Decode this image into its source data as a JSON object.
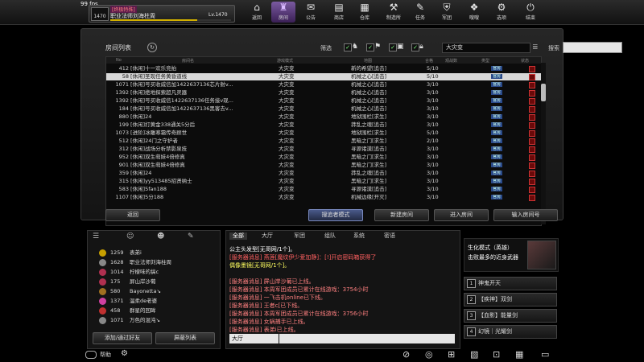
{
  "fps": "99 fps",
  "profile": {
    "rank": "1470",
    "tag": "[终极特殊]",
    "name": "职业法师刘海柱周",
    "level": "Lv.1470",
    "xp_fraction": 0.72
  },
  "topnav": [
    {
      "label": "返回",
      "icon": "⌂"
    },
    {
      "label": "房间",
      "icon": "♜"
    },
    {
      "label": "公告",
      "icon": "✉"
    },
    {
      "label": "商店",
      "icon": "▤"
    },
    {
      "label": "仓库",
      "icon": "▦"
    },
    {
      "label": "制造所",
      "icon": "⚒"
    },
    {
      "label": "任务",
      "icon": "✎"
    },
    {
      "label": "军团",
      "icon": "⛨"
    },
    {
      "label": "嗖嗖",
      "icon": "❖"
    },
    {
      "label": "选项",
      "icon": "⚙"
    },
    {
      "label": "结束",
      "icon": "⏻"
    }
  ],
  "room_list": {
    "title": "房间列表",
    "filter_label": "筛选",
    "mode_value": "大灾变",
    "search_label": "搜索",
    "search_value": "",
    "columns": [
      "No",
      "房间名",
      "游戏模式",
      "地图",
      "合格",
      "观战数",
      "类型",
      "状态"
    ],
    "rows": [
      {
        "no": "412",
        "name": "[休闲]十一欢乐竞拍",
        "mode": "大灾变",
        "map": "新的希望[追击]",
        "count": "5/10",
        "badge": "官房"
      },
      {
        "no": "58",
        "name": "[休闲]圣现任务黄昏道线",
        "mode": "大灾变",
        "map": "机械之心[追击]",
        "count": "5/10",
        "badge": "官房",
        "selected": true
      },
      {
        "no": "1071",
        "name": "[休闲]号买收威信加1422637136芯片射v...",
        "mode": "大灾变",
        "map": "机械之心[追击]",
        "count": "3/10",
        "badge": "官房"
      },
      {
        "no": "1392",
        "name": "[休闲]绝地探索超凡灵器",
        "mode": "大灾变",
        "map": "机械之心[追击]",
        "count": "3/10",
        "badge": "官房"
      },
      {
        "no": "1392",
        "name": "[休闲]号买收威信1422637136任务接v现...",
        "mode": "大灾变",
        "map": "机械之心[追击]",
        "count": "3/10",
        "badge": "官房"
      },
      {
        "no": "184",
        "name": "[休闲]号买收威信加1422637136黑客去v...",
        "mode": "大灾变",
        "map": "机械之心[追击]",
        "count": "3/10",
        "badge": "官房"
      },
      {
        "no": "880",
        "name": "[休闲]24",
        "mode": "大灾变",
        "map": "地狱围栏[求生]",
        "count": "3/10",
        "badge": "官房"
      },
      {
        "no": "199",
        "name": "[休闲]打黄金338通关5分后",
        "mode": "大灾变",
        "map": "莽乱之魂[追击]",
        "count": "3/10",
        "badge": "官房"
      },
      {
        "no": "1073",
        "name": "[进阶]冰雕寒霜传奇顾世",
        "mode": "大灾变",
        "map": "地狱围栏[求生]",
        "count": "5/10",
        "badge": "官房"
      },
      {
        "no": "512",
        "name": "[休闲]24门之守护者",
        "mode": "大灾变",
        "map": "黑暗之门[求生]",
        "count": "2/10",
        "badge": "官房"
      },
      {
        "no": "312",
        "name": "[休闲]战场分析禁影泉技",
        "mode": "大灾变",
        "map": "寻源诸漠[追击]",
        "count": "3/10",
        "badge": "官房"
      },
      {
        "no": "952",
        "name": "[休闲]双生萌妹4倍修真",
        "mode": "大灾变",
        "map": "黑暗之门[求生]",
        "count": "3/10",
        "badge": "官房"
      },
      {
        "no": "901",
        "name": "[休闲]双生萌妹4倍修真",
        "mode": "大灾变",
        "map": "黑暗之门[求生]",
        "count": "3/10",
        "badge": "官房"
      },
      {
        "no": "359",
        "name": "[休闲]24",
        "mode": "大灾变",
        "map": "莽乱之魂[追击]",
        "count": "3/10",
        "badge": "官房"
      },
      {
        "no": "315",
        "name": "[休闲]yy513485招贤纳士",
        "mode": "大灾变",
        "map": "黑暗之门[求生]",
        "count": "3/10",
        "badge": "官房"
      },
      {
        "no": "583",
        "name": "[休闲]5fan188",
        "mode": "大灾变",
        "map": "寻源诸漠[追击]",
        "count": "3/10",
        "badge": "官房"
      },
      {
        "no": "1107",
        "name": "[休闲]5分188",
        "mode": "大灾变",
        "map": "机械边缘[开灭]",
        "count": "3/10",
        "badge": "官房"
      }
    ],
    "buttons": {
      "back": "返回",
      "observer": "搜追者模式",
      "new_room": "新建房间",
      "enter_room": "进入房间",
      "enter_number": "输入房间号"
    }
  },
  "friends": {
    "items": [
      {
        "lv": "1259",
        "name": "表弟i",
        "color": "#c8a000"
      },
      {
        "lv": "1628",
        "name": "职业法师刘海柱周",
        "color": "#888"
      },
      {
        "lv": "1014",
        "name": "柠檬味的搞c",
        "color": "#b03050"
      },
      {
        "lv": "175",
        "name": "屏山岸沙葡",
        "color": "#b03050"
      },
      {
        "lv": "580",
        "name": "Bayonetta↘",
        "color": "#a07020"
      },
      {
        "lv": "1371",
        "name": "温柔de老婆",
        "color": "#d040a0"
      },
      {
        "lv": "458",
        "name": "群星的回眸",
        "color": "#c03030"
      },
      {
        "lv": "1071",
        "name": "万色的混沌↘",
        "color": "#888"
      }
    ],
    "add_button": "添加/通过好友",
    "block_button": "屏蔽列表"
  },
  "chat": {
    "tabs": [
      "全部",
      "大厅",
      "军团",
      "组队",
      "系统",
      "密语"
    ],
    "lines": [
      {
        "text": "公主头发型[无哥网/1个]。",
        "color": "#ffffff"
      },
      {
        "text": "[服务器消息] 燕莲[魔纹伊少爱加静]：[!]开启密码箱获得了",
        "color": "#ff6060"
      },
      {
        "text": "偶像墨镜[无哥网/1个]。",
        "color": "#ffff60"
      },
      {
        "text": "",
        "color": "#fff"
      },
      {
        "text": "[服务器消息] 屏山岸沙葡已上线。",
        "color": "#ff8080"
      },
      {
        "text": "[服务器消息] 本周军团成员已累计在线游戏：3754小时",
        "color": "#ff8080"
      },
      {
        "text": "[服务器消息] 一飞击机online已下线。",
        "color": "#ff8080"
      },
      {
        "text": "[服务器消息] 王者c[已下线。",
        "color": "#ff8080"
      },
      {
        "text": "[服务器消息] 本周军团成员已累计在线游戏：3756小时",
        "color": "#ff8080"
      },
      {
        "text": "[服务器消息] 女娲捕手已上线。",
        "color": "#ff8080"
      },
      {
        "text": "[服务器消息] 表弟i已上线。",
        "color": "#ff8080"
      }
    ],
    "channel": "大厅"
  },
  "side": {
    "title": "生化模式（英雄）",
    "subtitle": "击败最多的近身武器",
    "skills": [
      {
        "key": "1",
        "label": "神鬼开天"
      },
      {
        "key": "2",
        "label": "【疾神】双剑"
      },
      {
        "key": "3",
        "label": "【血影】能量剑"
      },
      {
        "key": "4",
        "label": "幻镜｜光耀剑"
      }
    ]
  },
  "bottom": {
    "help": "帮助"
  }
}
